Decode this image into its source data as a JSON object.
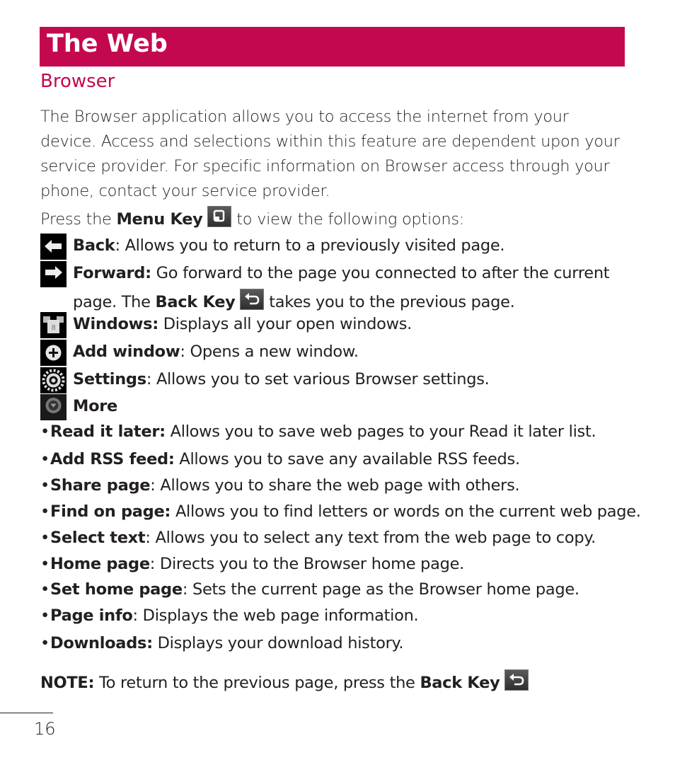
{
  "header": {
    "chapter_title": "The Web",
    "section_title": "Browser",
    "accent_color": "#c4084f"
  },
  "intro": "The Browser application allows you to access the internet from your device. Access and selections within this feature are dependent upon your service provider. For specific information on Browser access through your phone, contact your service provider.",
  "menu_line": {
    "prefix": "Press the ",
    "bold": "Menu Key",
    "suffix": " to view the following options:",
    "icon": "menu-key-icon"
  },
  "options": [
    {
      "icon": "back-arrow-icon",
      "label": "Back",
      "sep": ":",
      "desc": " Allows you to return to a previously visited page."
    },
    {
      "icon": "forward-arrow-icon",
      "label": "Forward:",
      "sep": "",
      "desc": " Go forward to the page you connected to after the current",
      "line2_prefix": "page. The ",
      "line2_bold": "Back Key",
      "line2_suffix": " takes you to the previous page."
    },
    {
      "icon": "windows-icon",
      "label": "Windows:",
      "sep": "",
      "desc": " Displays all your open windows."
    },
    {
      "icon": "add-window-icon",
      "label": "Add window",
      "sep": ":",
      "desc": " Opens a new window."
    },
    {
      "icon": "settings-gear-icon",
      "label": "Settings",
      "sep": ":",
      "desc": " Allows you to set various Browser settings."
    },
    {
      "icon": "more-icon",
      "label": "More",
      "sep": "",
      "desc": ""
    }
  ],
  "more_items": [
    {
      "label": "Read it later:",
      "sep": "",
      "desc": " Allows you to save web pages to your Read it later list."
    },
    {
      "label": "Add RSS feed:",
      "sep": "",
      "desc": " Allows you to save any available RSS feeds."
    },
    {
      "label": "Share page",
      "sep": ":",
      "desc": " Allows you to share the web page with others."
    },
    {
      "label": "Find on page:",
      "sep": "",
      "desc": " Allows you to find letters or words on the current web page."
    },
    {
      "label": "Select text",
      "sep": ":",
      "desc": " Allows you to select any text from the web page to copy."
    },
    {
      "label": "Home page",
      "sep": ":",
      "desc": " Directs you to the Browser home page."
    },
    {
      "label": "Set home page",
      "sep": ":",
      "desc": " Sets the current page as the Browser home page."
    },
    {
      "label": "Page info",
      "sep": ":",
      "desc": " Displays the web page information."
    },
    {
      "label": "Downloads:",
      "sep": "",
      "desc": " Displays your download history."
    }
  ],
  "note": {
    "label": "NOTE:",
    "text": " To return to the previous page, press the ",
    "bold": "Back Key"
  },
  "bullet_char": "•",
  "page_number": "16"
}
